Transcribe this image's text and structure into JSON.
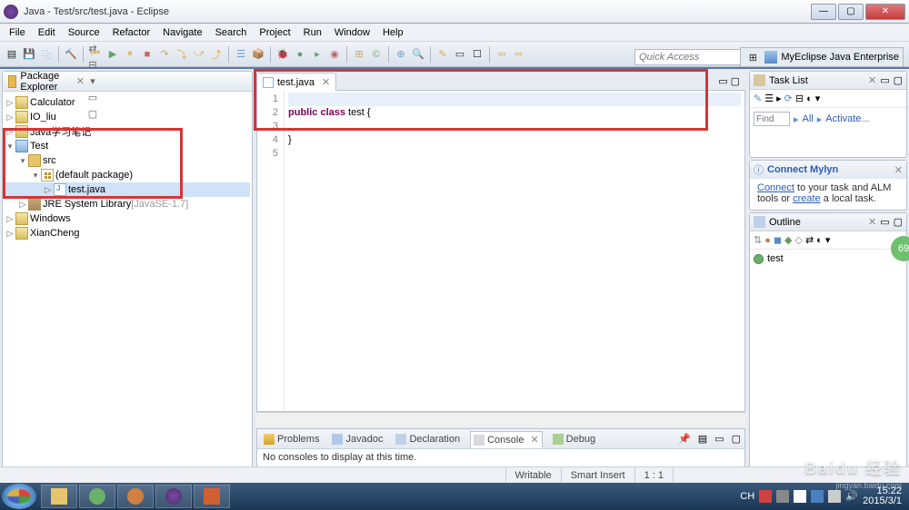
{
  "window": {
    "title": "Java - Test/src/test.java - Eclipse",
    "min": "—",
    "max": "▢",
    "close": "✕"
  },
  "menu": [
    "File",
    "Edit",
    "Source",
    "Refactor",
    "Navigate",
    "Search",
    "Project",
    "Run",
    "Window",
    "Help"
  ],
  "quick_access": "Quick Access",
  "perspective": "MyEclipse Java Enterprise",
  "package_explorer": {
    "title": "Package Explorer",
    "items": {
      "calculator": "Calculator",
      "io_liu": "IO_liu",
      "java_notes": "Java学习笔记",
      "test": "Test",
      "src": "src",
      "default_pkg": "(default package)",
      "test_java": "test.java",
      "jre": "JRE System Library",
      "jre_ver": "[JavaSE-1.7]",
      "windows": "Windows",
      "xiancheng": "XianCheng"
    }
  },
  "editor": {
    "tab": "test.java",
    "lines": [
      "1",
      "2",
      "3",
      "4",
      "5"
    ],
    "kw_public": "public",
    "kw_class": "class",
    "rest1": " test {",
    "brace": "}"
  },
  "bottom": {
    "problems": "Problems",
    "javadoc": "Javadoc",
    "declaration": "Declaration",
    "console": "Console",
    "debug": "Debug",
    "msg": "No consoles to display at this time."
  },
  "tasklist": {
    "title": "Task List",
    "find": "Find",
    "all": "All",
    "activate": "Activate..."
  },
  "mylyn": {
    "title": "Connect Mylyn",
    "connect": "Connect",
    "txt1": " to your task and ALM tools or ",
    "create": "create",
    "txt2": " a local task."
  },
  "outline": {
    "title": "Outline",
    "item": "test"
  },
  "status": {
    "writable": "Writable",
    "insert": "Smart Insert",
    "pos": "1 : 1"
  },
  "tray": {
    "ime": "CH",
    "time": "15:22",
    "date": "2015/3/1"
  },
  "watermark": "Baidu 经验",
  "watermark_url": "jingyan.baidu.com",
  "badge": "69"
}
